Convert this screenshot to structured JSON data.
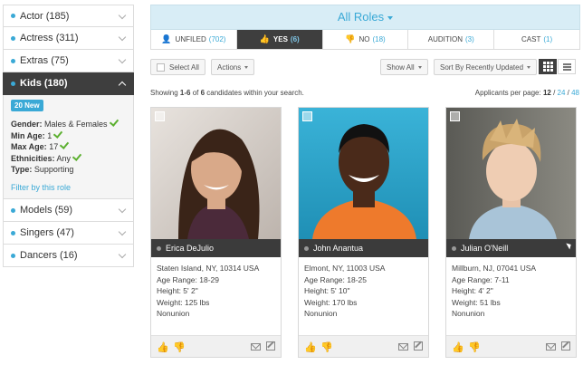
{
  "sidebar": {
    "roles": [
      {
        "label": "Actor (185)"
      },
      {
        "label": "Actress (311)"
      },
      {
        "label": "Extras (75)"
      },
      {
        "label": "Kids (180)"
      }
    ],
    "detail": {
      "badge": "20 New",
      "gender_label": "Gender:",
      "gender_value": "Males & Females",
      "min_age_label": "Min Age:",
      "min_age_value": "1",
      "max_age_label": "Max Age:",
      "max_age_value": "17",
      "ethnicities_label": "Ethnicities:",
      "ethnicities_value": "Any",
      "type_label": "Type:",
      "type_value": "Supporting",
      "filter_link": "Filter by this role"
    },
    "roles_after": [
      {
        "label": "Models (59)"
      },
      {
        "label": "Singers (47)"
      },
      {
        "label": "Dancers (16)"
      }
    ]
  },
  "header": {
    "title": "All Roles"
  },
  "tabs": [
    {
      "label": "UNFILED",
      "count": "(702)",
      "icon": "user-icon"
    },
    {
      "label": "YES",
      "count": "(6)",
      "icon": "thumbs-up-icon"
    },
    {
      "label": "NO",
      "count": "(18)",
      "icon": "thumbs-down-icon"
    },
    {
      "label": "AUDITION",
      "count": "(3)"
    },
    {
      "label": "CAST",
      "count": "(1)"
    }
  ],
  "toolbar": {
    "select_all": "Select All",
    "actions": "Actions",
    "show": "Show All",
    "sort": "Sort By Recently Updated"
  },
  "results": {
    "prefix": "Showing ",
    "range": "1-6",
    "of": " of ",
    "total": "6",
    "suffix": " candidates within your search.",
    "per_page_label": "Applicants per page: ",
    "per_page_current": "12",
    "sep1": " / ",
    "per_page_opt1": "24",
    "sep2": " / ",
    "per_page_opt2": "48"
  },
  "candidates": [
    {
      "name": "Erica DeJulio",
      "location": "Staten Island, NY, 10314 USA",
      "age_range": "Age Range: 18-29",
      "height": "Height: 5' 2\"",
      "weight": "Weight: 125 lbs",
      "union": "Nonunion"
    },
    {
      "name": "John Anantua",
      "location": "Elmont, NY, 11003 USA",
      "age_range": "Age Range: 18-25",
      "height": "Height: 5' 10\"",
      "weight": "Weight: 170 lbs",
      "union": "Nonunion"
    },
    {
      "name": "Julian O'Neill",
      "location": "Millburn, NJ, 07041 USA",
      "age_range": "Age Range: 7-11",
      "height": "Height: 4' 2\"",
      "weight": "Weight: 51 lbs",
      "union": "Nonunion"
    }
  ],
  "colors": {
    "accent": "#3aa9d6",
    "dark": "#3e3e3e",
    "check": "#5cb030"
  }
}
